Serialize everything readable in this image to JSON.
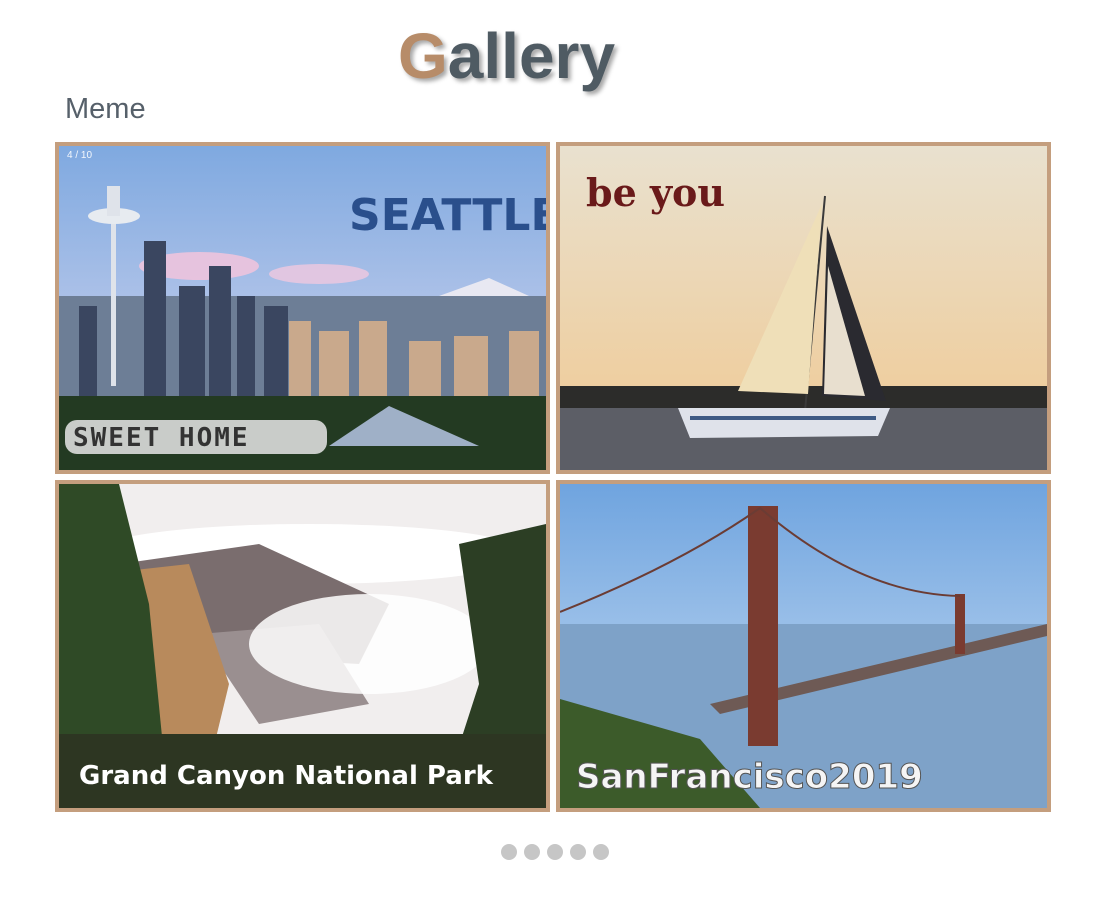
{
  "header": {
    "title_first_letter": "G",
    "title_rest": "allery",
    "subtitle": "Meme"
  },
  "gallery": {
    "counter": "4 / 10",
    "tiles": [
      {
        "caption_top": "SEATTLE",
        "caption_bottom": "SWEET HOME"
      },
      {
        "caption_top": "be you"
      },
      {
        "caption_bottom": "Grand Canyon National Park"
      },
      {
        "caption_bottom": "SanFrancisco2019"
      }
    ]
  },
  "pagination": {
    "dot_count": 5
  },
  "colors": {
    "accent": "#b78c69",
    "title": "#4f5b63",
    "frame": "#c49e7e",
    "dot": "#c6c6c6"
  }
}
